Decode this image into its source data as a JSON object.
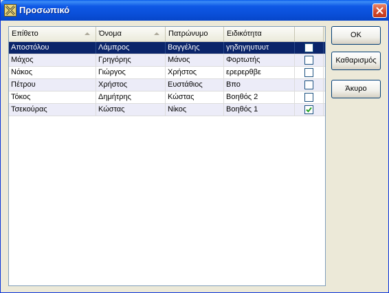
{
  "window": {
    "title": "Προσωπικό"
  },
  "table": {
    "columns": [
      "Επίθετο",
      "Όνομα",
      "Πατρώνυμο",
      "Ειδικότητα",
      ""
    ],
    "rows": [
      {
        "c0": "Αποστόλου",
        "c1": "Λάμπρος",
        "c2": "Βαγγέλης",
        "c3": "γηδηγηυτυυτ",
        "checked": false,
        "selected": true
      },
      {
        "c0": "Μάχος",
        "c1": "Γρηγόρης",
        "c2": "Μάνος",
        "c3": "Φορτωτής",
        "checked": false,
        "selected": false
      },
      {
        "c0": "Νάκος",
        "c1": "Γιώργος",
        "c2": "Χρήστος",
        "c3": "ερερερθβε",
        "checked": false,
        "selected": false
      },
      {
        "c0": "Πέτρου",
        "c1": "Χρήστος",
        "c2": "Ευστάθιος",
        "c3": "Βπο",
        "checked": false,
        "selected": false
      },
      {
        "c0": "Τόκος",
        "c1": "Δημήτρης",
        "c2": "Κώστας",
        "c3": "Βοηθός 2",
        "checked": false,
        "selected": false
      },
      {
        "c0": "Τσεκούρας",
        "c1": "Κώστας",
        "c2": "Νίκος",
        "c3": "Βοηθός 1",
        "checked": true,
        "selected": false
      }
    ]
  },
  "buttons": {
    "ok": "ΟΚ",
    "clear": "Καθαρισμός",
    "cancel": "Άκυρο"
  },
  "colors": {
    "selection": "#0a246a",
    "titlebar": "#0a4fd8",
    "check": "#21a121"
  }
}
